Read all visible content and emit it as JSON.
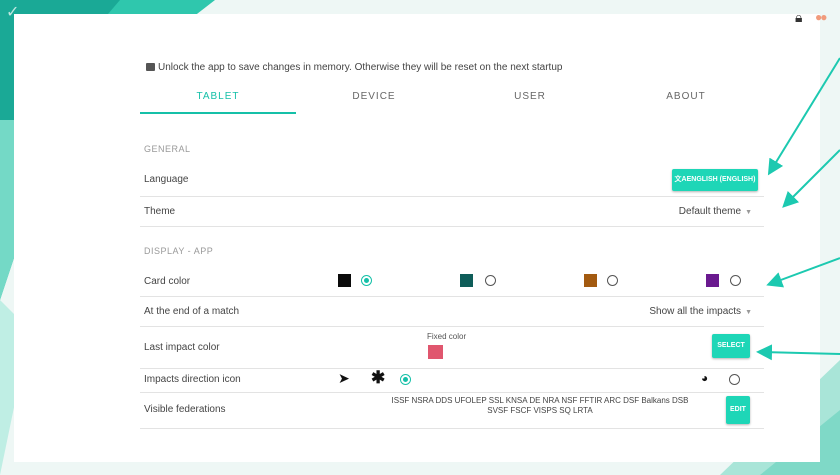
{
  "notice": "Unlock the app to save changes in memory. Otherwise they will be reset on the next startup",
  "tabs": [
    {
      "label": "TABLET"
    },
    {
      "label": "DEVICE"
    },
    {
      "label": "USER"
    },
    {
      "label": "ABOUT"
    }
  ],
  "general": {
    "section_label": "GENERAL",
    "language_label": "Language",
    "language_value": "ENGLISH (ENGLISH)",
    "theme_label": "Theme",
    "theme_value": "Default theme"
  },
  "display": {
    "section_label": "DISPLAY - APP",
    "card_color_label": "Card color",
    "card_colors": [
      {
        "color": "#0b0b0b",
        "selected": true
      },
      {
        "color": "#0e5d59",
        "selected": false
      },
      {
        "color": "#a35a10",
        "selected": false
      },
      {
        "color": "#6a1a8f",
        "selected": false
      }
    ],
    "end_of_match_label": "At the end of a match",
    "end_of_match_value": "Show all the impacts",
    "last_impact_label": "Last impact color",
    "fixed_color_label": "Fixed color",
    "fixed_color": "#e0566e",
    "select_button": "SELECT",
    "impacts_icon_label": "Impacts direction icon",
    "visible_federations_label": "Visible federations",
    "federations_line1": "ISSF NSRA DDS UFOLEP SSL KNSA DE NRA NSF FFTIR ARC DSF Balkans DSB",
    "federations_line2": "SVSF FSCF VISPS SQ LRTA",
    "edit_button": "EDIT"
  },
  "colors": {
    "accent": "#15c0a8",
    "button": "#1ed6b7",
    "annotation": "#1cc9b0"
  }
}
